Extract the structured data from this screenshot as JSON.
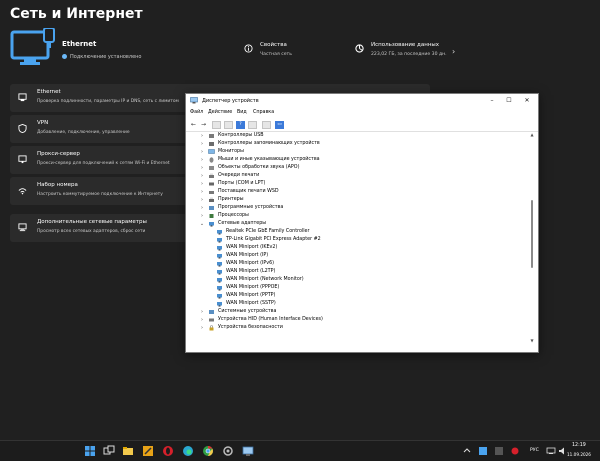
{
  "page": {
    "title": "Сеть и Интернет"
  },
  "hero": {
    "title": "Ethernet",
    "status": "Подключение установлено",
    "props": [
      {
        "title": "Свойства",
        "sub": "Частная сеть"
      },
      {
        "title": "Использование данных",
        "sub": "223,02 ГБ, за последние 30 дн."
      }
    ]
  },
  "list": [
    {
      "title": "Ethernet",
      "sub": "Проверка подлинности, параметры IP и DNS, сеть с лимитом"
    },
    {
      "title": "VPN",
      "sub": "Добавление, подключение, управление"
    },
    {
      "title": "Прокси-сервер",
      "sub": "Прокси-сервер для подключений к сетям Wi-Fi и Ethernet"
    },
    {
      "title": "Набор номера",
      "sub": "Настроить коммутируемое подключение к Интернету"
    },
    {
      "title": "Дополнительные сетевые параметры",
      "sub": "Просмотр всех сетевых адаптеров, сброс сети"
    }
  ],
  "device_manager": {
    "title": "Диспетчер устройств",
    "menu": [
      "Файл",
      "Действие",
      "Вид",
      "Справка"
    ],
    "categories_top": [
      "Контроллеры USB",
      "Контроллеры запоминающих устройств",
      "Мониторы",
      "Мыши и иные указывающие устройства",
      "Объекты обработки звука (APO)",
      "Очереди печати",
      "Порты (COM и LPT)",
      "Поставщик печати WSD",
      "Принтеры",
      "Программные устройства",
      "Процессоры"
    ],
    "expanded_category": "Сетевые адаптеры",
    "adapters": [
      "Realtek PCIe GbE Family Controller",
      "TP-Link Gigabit PCI Express Adapter #2",
      "WAN Miniport (IKEv2)",
      "WAN Miniport (IP)",
      "WAN Miniport (IPv6)",
      "WAN Miniport (L2TP)",
      "WAN Miniport (Network Monitor)",
      "WAN Miniport (PPPOE)",
      "WAN Miniport (PPTP)",
      "WAN Miniport (SSTP)"
    ],
    "categories_bottom": [
      "Системные устройства",
      "Устройства HID (Human Interface Devices)",
      "Устройства безопасности"
    ]
  },
  "taskbar": {
    "lang": "РУС",
    "time": "12:19",
    "date": "11.09.2026"
  },
  "colors": {
    "accent": "#4aa3ef",
    "settings_bg": "#202020",
    "card_bg": "#2b2b2b"
  }
}
